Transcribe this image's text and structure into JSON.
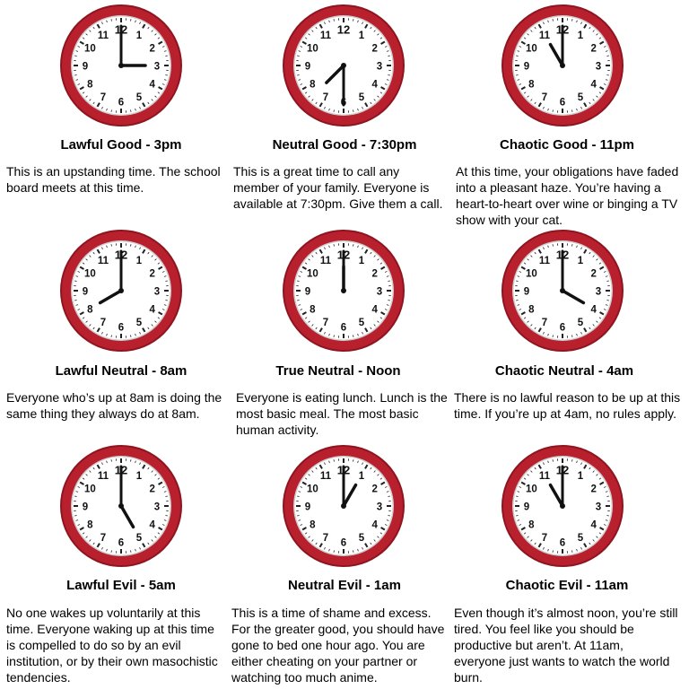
{
  "colors": {
    "rim": "#b9202d",
    "rim_dark": "#8e1520",
    "face": "#ffffff",
    "hands": "#111111"
  },
  "clock_numbers": [
    "12",
    "1",
    "2",
    "3",
    "4",
    "5",
    "6",
    "7",
    "8",
    "9",
    "10",
    "11"
  ],
  "cells": [
    {
      "title": "Lawful Good - 3pm",
      "hour": 3,
      "minute": 0,
      "desc": "This is an upstanding time. The school board meets at this time."
    },
    {
      "title": "Neutral Good - 7:30pm",
      "hour": 7,
      "minute": 30,
      "desc": "This is a great time to call any member of your family. Everyone is available at 7:30pm. Give them a call."
    },
    {
      "title": "Chaotic Good - 11pm",
      "hour": 11,
      "minute": 0,
      "desc": "At this time, your obligations have faded into a pleasant haze. You’re having a heart-to-heart over wine or binging a TV show with your cat."
    },
    {
      "title": "Lawful Neutral - 8am",
      "hour": 8,
      "minute": 0,
      "desc": "Everyone who’s up at 8am is doing the same thing they always do at 8am."
    },
    {
      "title": "True Neutral - Noon",
      "hour": 12,
      "minute": 0,
      "desc": "Everyone is eating lunch. Lunch is the most basic meal. The most basic human activity."
    },
    {
      "title": "Chaotic Neutral - 4am",
      "hour": 4,
      "minute": 0,
      "desc": "There is no lawful reason to be up at this time. If you’re up at 4am, no rules apply."
    },
    {
      "title": "Lawful Evil - 5am",
      "hour": 5,
      "minute": 0,
      "desc": "No one wakes up voluntarily at this time. Everyone waking up at this time is compelled to do so by an evil institution, or by their own masochistic tendencies."
    },
    {
      "title": "Neutral Evil - 1am",
      "hour": 1,
      "minute": 0,
      "desc": "This is a time of shame and excess. For the greater good, you should have gone to bed one hour ago. You are either cheating on your partner or watching too much anime."
    },
    {
      "title": "Chaotic Evil - 11am",
      "hour": 11,
      "minute": 0,
      "desc": "Even though it’s almost noon, you’re still tired. You feel like you should be productive but aren’t.  At 11am, everyone just wants to watch the world burn."
    }
  ]
}
